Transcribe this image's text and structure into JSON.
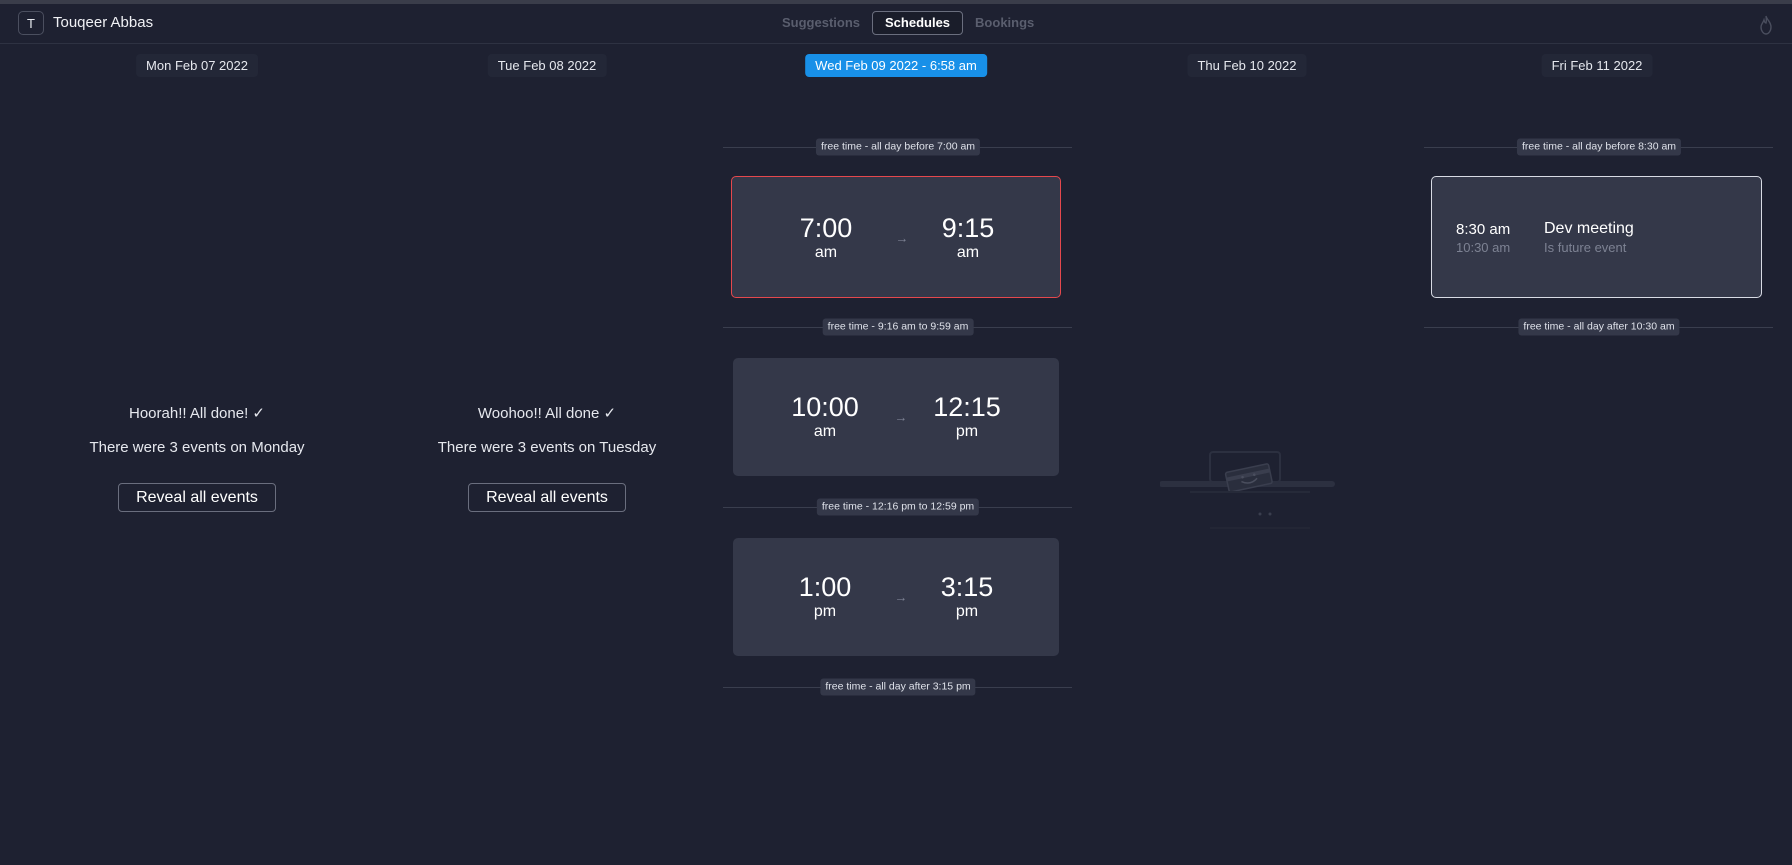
{
  "user": {
    "initial": "T",
    "name": "Touqeer Abbas"
  },
  "tabs": [
    "Suggestions",
    "Schedules",
    "Bookings"
  ],
  "days": [
    {
      "label": "Mon Feb 07 2022"
    },
    {
      "label": "Tue Feb 08 2022"
    },
    {
      "label": "Wed Feb 09 2022 - 6:58 am",
      "today": true
    },
    {
      "label": "Thu Feb 10 2022"
    },
    {
      "label": "Fri Feb 11 2022"
    }
  ],
  "monday": {
    "done": "Hoorah!! All done! ✓",
    "summary": "There were 3 events on Monday",
    "button": "Reveal all events"
  },
  "tuesday": {
    "done": "Woohoo!! All done ✓",
    "summary": "There were 3 events on Tuesday",
    "button": "Reveal all events"
  },
  "wednesday": {
    "free": [
      "free time - all day before 7:00 am",
      "free time - 9:16 am to 9:59 am",
      "free time - 12:16 pm to 12:59 pm",
      "free time - all day after 3:15 pm"
    ],
    "events": [
      {
        "start": "7:00",
        "start_ampm": "am",
        "end": "9:15",
        "end_ampm": "am"
      },
      {
        "start": "10:00",
        "start_ampm": "am",
        "end": "12:15",
        "end_ampm": "pm"
      },
      {
        "start": "1:00",
        "start_ampm": "pm",
        "end": "3:15",
        "end_ampm": "pm"
      }
    ],
    "arrow": "→"
  },
  "friday": {
    "free": [
      "free time - all day before 8:30 am",
      "free time - all day after 10:30 am"
    ],
    "event": {
      "start": "8:30 am",
      "end": "10:30 am",
      "title": "Dev meeting",
      "subtitle": "Is future event"
    }
  },
  "colors": {
    "accent": "#1890e8",
    "selected_border": "#e5484d",
    "background": "#1e2131",
    "card": "#343849"
  },
  "icons": [
    "flame-icon",
    "empty-state-illustration"
  ]
}
